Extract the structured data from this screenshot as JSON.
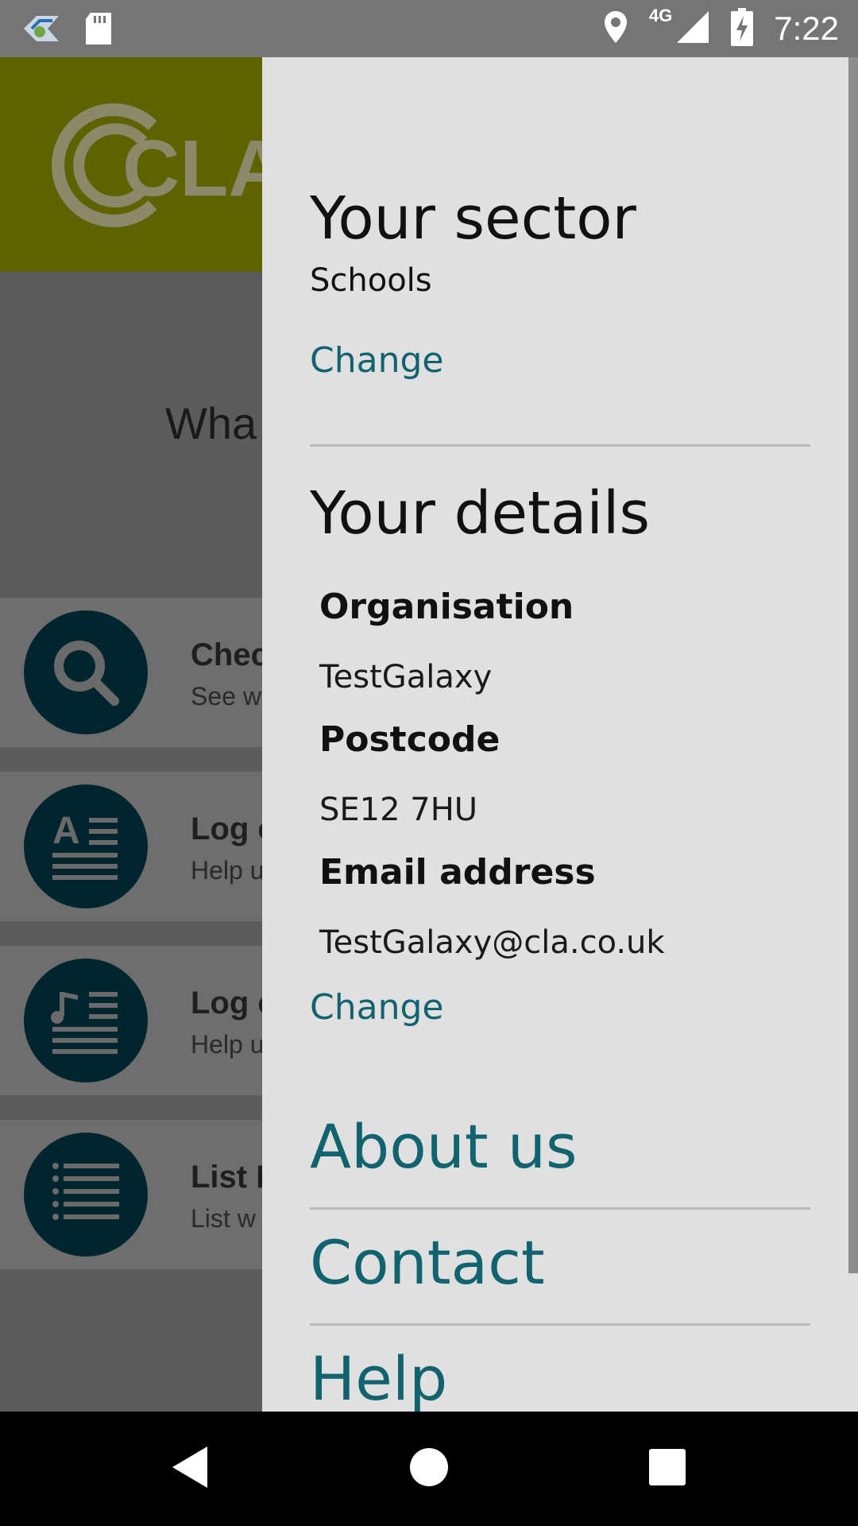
{
  "status_bar": {
    "time": "7:22",
    "network": "4G",
    "icons": [
      "app-notification-icon",
      "sd-card-icon",
      "location-icon",
      "signal-icon",
      "battery-charging-icon"
    ]
  },
  "background": {
    "logo_text": "CLA",
    "header_color": "#5e6300",
    "question_text": "Wha",
    "cards": [
      {
        "icon": "search-icon",
        "title": "Chec",
        "subtitle": "See w"
      },
      {
        "icon": "text-log-icon",
        "title": "Log c",
        "subtitle": "Help u"
      },
      {
        "icon": "music-log-icon",
        "title": "Log c",
        "subtitle": "Help u"
      },
      {
        "icon": "list-icon",
        "title": "List P",
        "subtitle": "List w"
      }
    ]
  },
  "drawer": {
    "sector": {
      "heading": "Your sector",
      "value": "Schools",
      "change_label": "Change"
    },
    "details": {
      "heading": "Your details",
      "organisation_label": "Organisation",
      "organisation_value": "TestGalaxy",
      "postcode_label": "Postcode",
      "postcode_value": "SE12 7HU",
      "email_label": "Email address",
      "email_value": "TestGalaxy@cla.co.uk",
      "change_label": "Change"
    },
    "links": {
      "about": "About us",
      "contact": "Contact",
      "help": "Help"
    },
    "link_color": "#11636f"
  },
  "nav_bar": {
    "icons": [
      "back-icon",
      "home-icon",
      "recents-icon"
    ]
  }
}
